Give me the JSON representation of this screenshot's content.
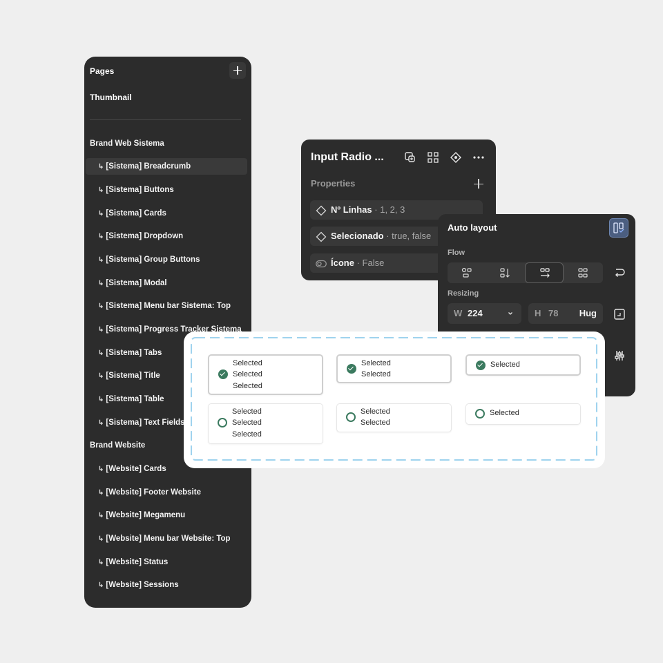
{
  "pages_panel": {
    "title": "Pages",
    "thumbnail": "Thumbnail",
    "section_sistema": "Brand Web Sistema",
    "sistema_pages": [
      "[Sistema] Breadcrumb",
      "[Sistema] Buttons",
      "[Sistema] Cards",
      "[Sistema] Dropdown",
      "[Sistema] Group Buttons",
      "[Sistema] Modal",
      "[Sistema] Menu bar Sistema: Top",
      "[Sistema] Progress Tracker Sistema",
      "[Sistema] Tabs",
      "[Sistema] Title",
      "[Sistema] Table",
      "[Sistema] Text Fields"
    ],
    "selected_page": "[Sistema] Breadcrumb",
    "section_website": "Brand Website",
    "website_pages": [
      "[Website] Cards",
      "[Website] Footer Website",
      "[Website] Megamenu",
      "[Website] Menu bar Website: Top",
      "[Website] Status",
      "[Website] Sessions"
    ],
    "page_arrow": "↳"
  },
  "properties_panel": {
    "component_name": "Input Radio ...",
    "section_label": "Properties",
    "props": [
      {
        "name": "Nº Linhas",
        "value": "· 1, 2, 3",
        "icon": "variant-diamond-icon"
      },
      {
        "name": "Selecionado",
        "value": "· true, false",
        "icon": "variant-diamond-icon"
      },
      {
        "name": "Ícone",
        "value": "· False",
        "icon": "boolean-toggle-icon"
      }
    ]
  },
  "auto_layout_panel": {
    "title": "Auto layout",
    "flow_label": "Flow",
    "flow_selected": "horizontal",
    "resizing_label": "Resizing",
    "width_key": "W",
    "width_value": "224",
    "height_key": "H",
    "height_value": "78",
    "height_mode": "Hug"
  },
  "canvas": {
    "cards": [
      {
        "checked": true,
        "lines": [
          "Selected",
          "Selected",
          "Selected"
        ]
      },
      {
        "checked": true,
        "lines": [
          "Selected",
          "Selected"
        ]
      },
      {
        "checked": true,
        "lines": [
          "Selected"
        ]
      },
      {
        "checked": false,
        "lines": [
          "Selected",
          "Selected",
          "Selected"
        ]
      },
      {
        "checked": false,
        "lines": [
          "Selected",
          "Selected"
        ]
      },
      {
        "checked": false,
        "lines": [
          "Selected"
        ]
      }
    ]
  },
  "colors": {
    "panel_bg": "#2c2c2c",
    "page_bg": "#efefef",
    "radio_accent": "#3b7a5f",
    "dash_border": "#9fd3ee",
    "auto_layout_active": "#4b5e80"
  }
}
